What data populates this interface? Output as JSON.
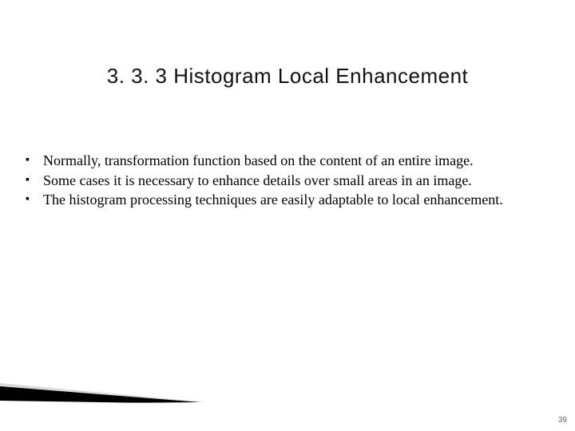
{
  "title": "3. 3. 3 Histogram Local Enhancement",
  "bullets": [
    "Normally, transformation function based on the content of an entire image.",
    "Some cases it is necessary to enhance details over small areas in an image.",
    "The histogram processing techniques are easily adaptable to local enhancement."
  ],
  "page_number": "39"
}
